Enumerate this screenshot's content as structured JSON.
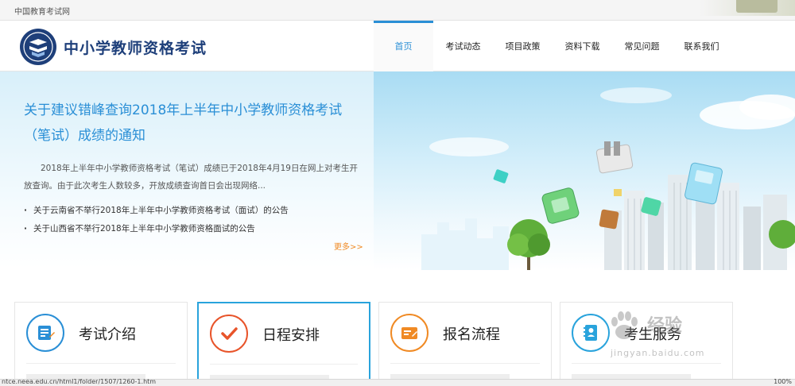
{
  "topbar": {
    "site_name": "中国教育考试网"
  },
  "header": {
    "brand": "中小学教师资格考试"
  },
  "nav": {
    "items": [
      {
        "label": "首页",
        "active": true
      },
      {
        "label": "考试动态"
      },
      {
        "label": "项目政策"
      },
      {
        "label": "资料下载"
      },
      {
        "label": "常见问题"
      },
      {
        "label": "联系我们"
      }
    ]
  },
  "banner": {
    "headline": "关于建议错峰查询2018年上半年中小学教师资格考试（笔试）成绩的通知",
    "summary": "2018年上半年中小学教师资格考试（笔试）成绩已于2018年4月19日在网上对考生开放查询。由于此次考生人数较多，开放成绩查询首日会出现网络...",
    "news": [
      "关于云南省不举行2018年上半年中小学教师资格考试（面试）的公告",
      "关于山西省不举行2018年上半年中小学教师资格面试的公告"
    ],
    "more": "更多>>"
  },
  "cards": [
    {
      "title": "考试介绍",
      "icon": "exam-intro-icon",
      "color": "#2a8fd6"
    },
    {
      "title": "日程安排",
      "icon": "checkmark-icon",
      "color": "#e8542a"
    },
    {
      "title": "报名流程",
      "icon": "registration-icon",
      "color": "#f08a24"
    },
    {
      "title": "考生服务",
      "icon": "service-book-icon",
      "color": "#29a3dc"
    }
  ],
  "status": {
    "url": "ntce.neea.edu.cn/html1/folder/1507/1260-1.htm",
    "zoom": "100%"
  },
  "watermark": {
    "text": "经验",
    "sub": "jingyan.baidu.com"
  },
  "colors": {
    "accent": "#2a8fd6",
    "brand": "#1e3f7a",
    "more": "#f08a24"
  }
}
